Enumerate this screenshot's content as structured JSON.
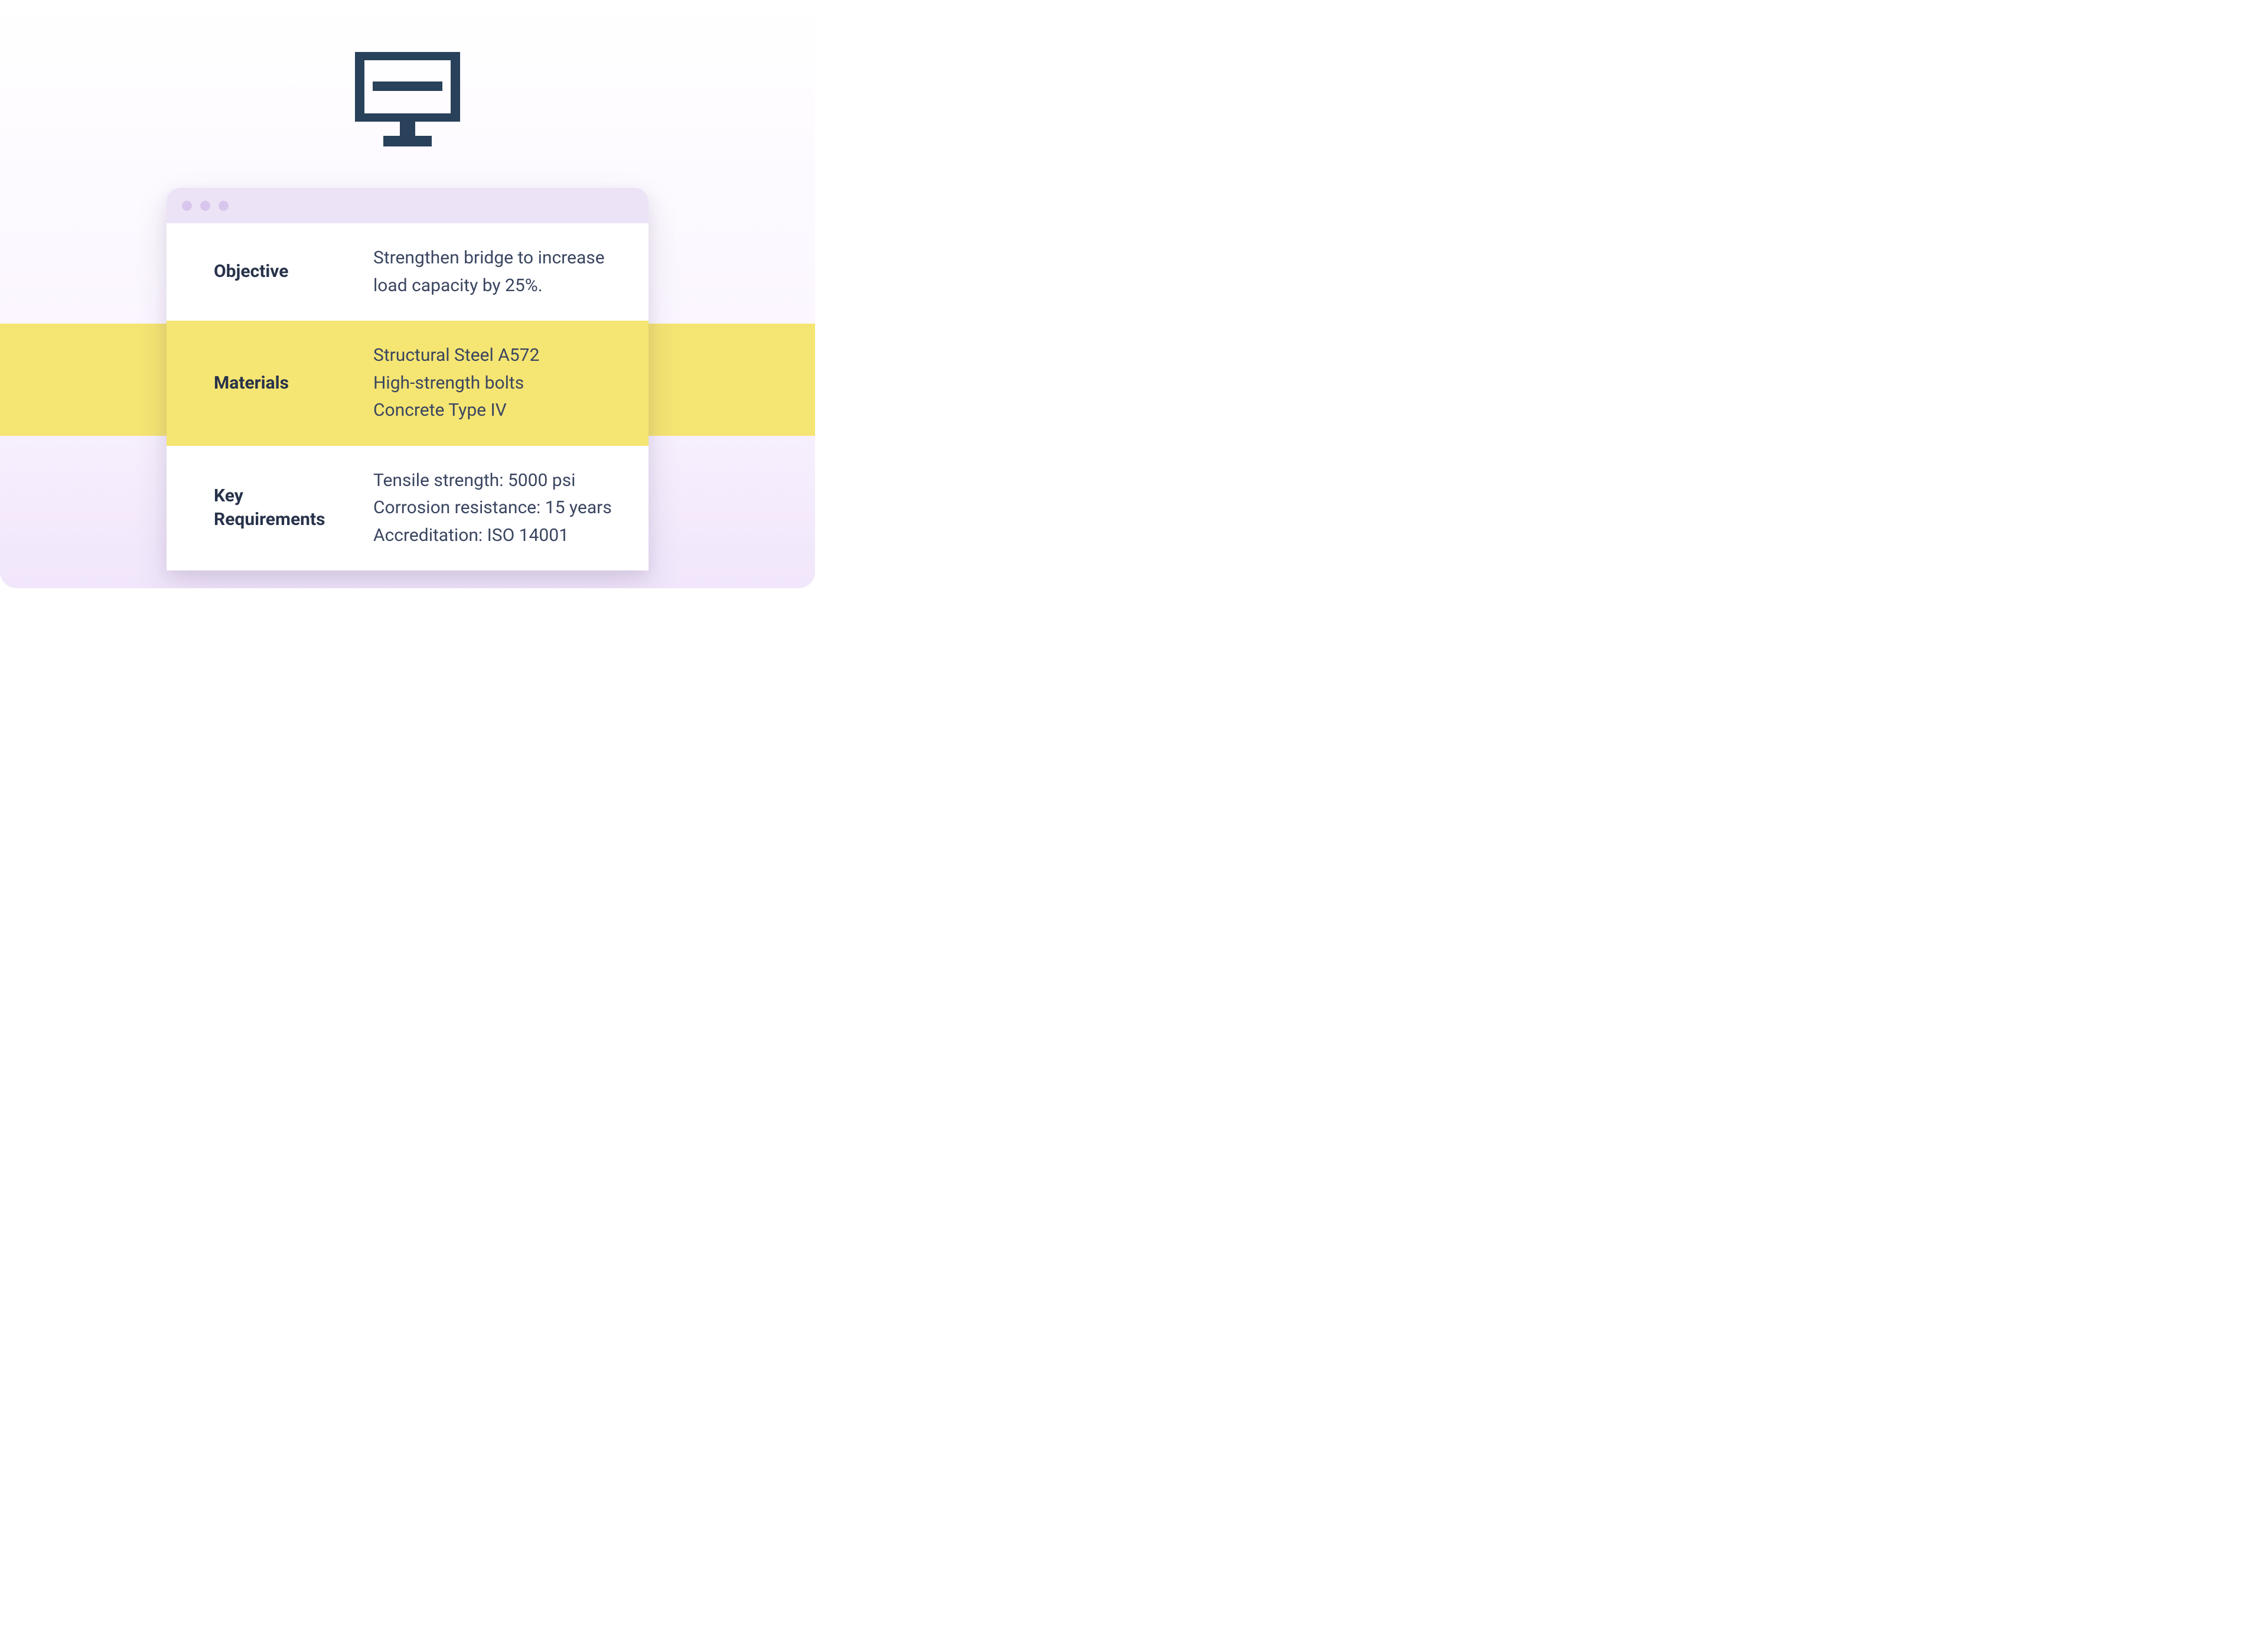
{
  "icon": {
    "name": "monitor-icon",
    "color": "#29415a"
  },
  "band": {
    "color": "#f5e573"
  },
  "window": {
    "titlebar_color": "#ede3f7",
    "dot_color": "#d9c6ec",
    "rows": [
      {
        "label": "Objective",
        "value": "Strengthen bridge to increase load capacity by 25%.",
        "highlight": false
      },
      {
        "label": "Materials",
        "value": "Structural Steel A572\nHigh-strength bolts\nConcrete Type IV",
        "highlight": true
      },
      {
        "label": "Key Requirements",
        "value": "Tensile strength: 5000 psi\nCorrosion resistance: 15 years\nAccreditation: ISO 14001",
        "highlight": false
      }
    ]
  }
}
